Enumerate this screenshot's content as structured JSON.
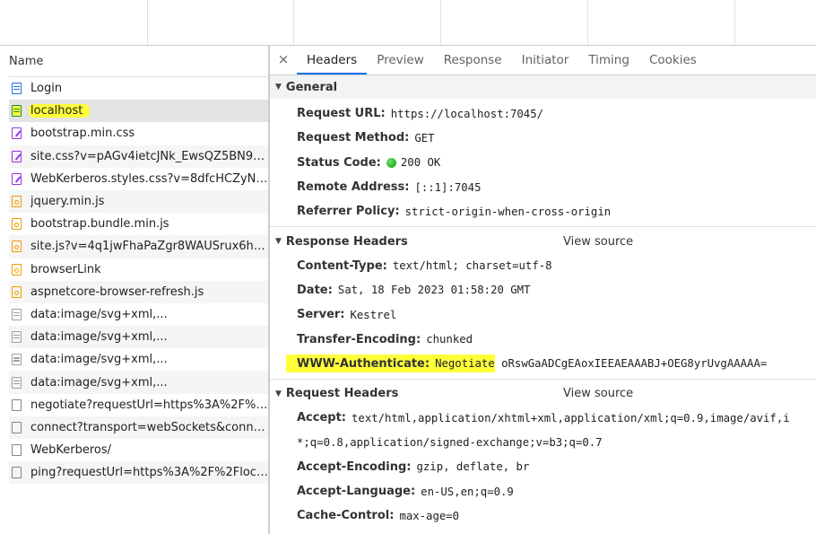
{
  "left": {
    "name_header": "Name",
    "rows": [
      {
        "label": "Login",
        "icon": "document-icon",
        "type": "doc"
      },
      {
        "label": "localhost",
        "icon": "document-icon",
        "type": "docg",
        "selected": true
      },
      {
        "label": "bootstrap.min.css",
        "icon": "stylesheet-icon",
        "type": "css"
      },
      {
        "label": "site.css?v=pAGv4ietcJNk_EwsQZ5BN9-...",
        "icon": "stylesheet-icon",
        "type": "css"
      },
      {
        "label": "WebKerberos.styles.css?v=8dfcHCZyNu...",
        "icon": "stylesheet-icon",
        "type": "css"
      },
      {
        "label": "jquery.min.js",
        "icon": "script-icon",
        "type": "js"
      },
      {
        "label": "bootstrap.bundle.min.js",
        "icon": "script-icon",
        "type": "js"
      },
      {
        "label": "site.js?v=4q1jwFhaPaZgr8WAUSrux6hA...",
        "icon": "script-icon",
        "type": "js"
      },
      {
        "label": "browserLink",
        "icon": "script-icon",
        "type": "js"
      },
      {
        "label": "aspnetcore-browser-refresh.js",
        "icon": "script-icon",
        "type": "js"
      },
      {
        "label": "data:image/svg+xml,...",
        "icon": "image-icon",
        "type": "img"
      },
      {
        "label": "data:image/svg+xml,...",
        "icon": "image-icon",
        "type": "img"
      },
      {
        "label": "data:image/svg+xml,...",
        "icon": "image-icon",
        "type": "img"
      },
      {
        "label": "data:image/svg+xml,...",
        "icon": "image-icon",
        "type": "img"
      },
      {
        "label": "negotiate?requestUrl=https%3A%2F%2...",
        "icon": "file-icon",
        "type": "plain"
      },
      {
        "label": "connect?transport=webSockets&conne...",
        "icon": "file-icon",
        "type": "plain"
      },
      {
        "label": "WebKerberos/",
        "icon": "file-icon",
        "type": "plain"
      },
      {
        "label": "ping?requestUrl=https%3A%2F%2Floca...",
        "icon": "file-icon",
        "type": "plain"
      }
    ]
  },
  "tabs": {
    "close": "×",
    "items": [
      "Headers",
      "Preview",
      "Response",
      "Initiator",
      "Timing",
      "Cookies"
    ],
    "active": "Headers"
  },
  "general": {
    "title": "General",
    "request_url_k": "Request URL:",
    "request_url_v": "https://localhost:7045/",
    "method_k": "Request Method:",
    "method_v": "GET",
    "status_k": "Status Code:",
    "status_v": "200 OK",
    "remote_k": "Remote Address:",
    "remote_v": "[::1]:7045",
    "referrer_k": "Referrer Policy:",
    "referrer_v": "strict-origin-when-cross-origin"
  },
  "response_headers": {
    "title": "Response Headers",
    "view_source": "View source",
    "ct_k": "Content-Type:",
    "ct_v": "text/html; charset=utf-8",
    "date_k": "Date:",
    "date_v": "Sat, 18 Feb 2023 01:58:20 GMT",
    "server_k": "Server:",
    "server_v": "Kestrel",
    "te_k": "Transfer-Encoding:",
    "te_v": "chunked",
    "www_k": "WWW-Authenticate:",
    "www_v1": "Negotiate",
    "www_v2": " oRswGaADCgEAoxIEEAEAAABJ+OEG8yrUvgAAAAA="
  },
  "request_headers": {
    "title": "Request Headers",
    "view_source": "View source",
    "accept_k": "Accept:",
    "accept_v": "text/html,application/xhtml+xml,application/xml;q=0.9,image/avif,i",
    "accept_cont": "*;q=0.8,application/signed-exchange;v=b3;q=0.7",
    "ae_k": "Accept-Encoding:",
    "ae_v": "gzip, deflate, br",
    "al_k": "Accept-Language:",
    "al_v": "en-US,en;q=0.9",
    "cc_k": "Cache-Control:",
    "cc_v": "max-age=0"
  },
  "colors": {
    "highlight": "#ffff3a",
    "accent": "#1a73e8",
    "status_ok": "#0a9b0a"
  }
}
